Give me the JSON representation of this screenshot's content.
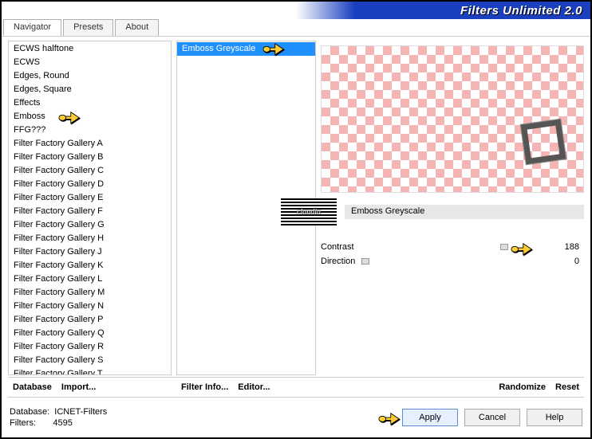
{
  "title": "Filters Unlimited 2.0",
  "tabs": [
    {
      "label": "Navigator",
      "active": true
    },
    {
      "label": "Presets",
      "active": false
    },
    {
      "label": "About",
      "active": false
    }
  ],
  "category_list": [
    "ECWS halftone",
    "ECWS",
    "Edges, Round",
    "Edges, Square",
    "Effects",
    "Emboss",
    "FFG???",
    "Filter Factory Gallery A",
    "Filter Factory Gallery B",
    "Filter Factory Gallery C",
    "Filter Factory Gallery D",
    "Filter Factory Gallery E",
    "Filter Factory Gallery F",
    "Filter Factory Gallery G",
    "Filter Factory Gallery H",
    "Filter Factory Gallery J",
    "Filter Factory Gallery K",
    "Filter Factory Gallery L",
    "Filter Factory Gallery M",
    "Filter Factory Gallery N",
    "Filter Factory Gallery P",
    "Filter Factory Gallery Q",
    "Filter Factory Gallery R",
    "Filter Factory Gallery S",
    "Filter Factory Gallery T"
  ],
  "filter_list": [
    {
      "label": "Emboss Greyscale",
      "selected": true
    }
  ],
  "selected_filter_name": "Emboss Greyscale",
  "logo_text": "claudia",
  "sliders": [
    {
      "label": "Contrast",
      "value": "188",
      "pos": 74
    },
    {
      "label": "Direction",
      "value": "0",
      "pos": 0
    }
  ],
  "buttons_left": {
    "database": "Database",
    "import": "Import..."
  },
  "buttons_mid": {
    "filterinfo": "Filter Info...",
    "editor": "Editor..."
  },
  "buttons_right": {
    "randomize": "Randomize",
    "reset": "Reset"
  },
  "status": {
    "db_label": "Database:",
    "db_value": "ICNET-Filters",
    "filters_label": "Filters:",
    "filters_value": "4595"
  },
  "bottom_buttons": {
    "apply": "Apply",
    "cancel": "Cancel",
    "help": "Help"
  }
}
